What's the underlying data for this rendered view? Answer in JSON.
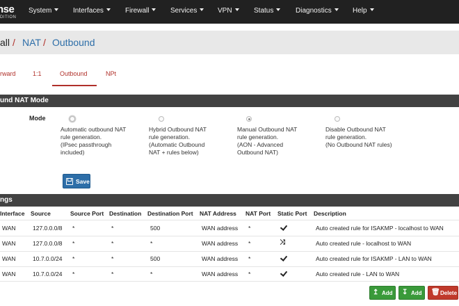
{
  "nav": {
    "brand_main": "nse",
    "brand_sub": "DITION",
    "items": [
      {
        "label": "System"
      },
      {
        "label": "Interfaces"
      },
      {
        "label": "Firewall"
      },
      {
        "label": "Services"
      },
      {
        "label": "VPN"
      },
      {
        "label": "Status"
      },
      {
        "label": "Diagnostics"
      },
      {
        "label": "Help"
      }
    ]
  },
  "breadcrumb": {
    "part1": "all",
    "sep1": "/",
    "part2": "NAT",
    "sep2": "/",
    "part3": "Outbound"
  },
  "tabs": [
    {
      "label": "rward"
    },
    {
      "label": "1:1"
    },
    {
      "label": "Outbound",
      "active": true
    },
    {
      "label": "NPt"
    }
  ],
  "mode_section": {
    "title": "und NAT Mode",
    "mode_label": "Mode",
    "options": [
      {
        "lines": [
          "Automatic outbound NAT",
          "rule generation.",
          "(IPsec passthrough",
          "included)"
        ],
        "checked": false,
        "focus": true
      },
      {
        "lines": [
          "Hybrid Outbound NAT",
          "rule generation.",
          "(Automatic Outbound",
          "NAT + rules below)"
        ],
        "checked": false
      },
      {
        "lines": [
          "Manual Outbound NAT",
          "rule generation.",
          "(AON - Advanced",
          "Outbound NAT)"
        ],
        "checked": true
      },
      {
        "lines": [
          "Disable Outbound NAT",
          "rule generation.",
          "(No Outbound NAT rules)"
        ],
        "checked": false
      }
    ],
    "save_label": "Save"
  },
  "mappings": {
    "title": "ngs",
    "columns": [
      "Interface",
      "Source",
      "Source Port",
      "Destination",
      "Destination Port",
      "NAT Address",
      "NAT Port",
      "Static Port",
      "Description"
    ],
    "rows": [
      {
        "interface": "WAN",
        "source": "127.0.0.0/8",
        "source_port": "*",
        "destination": "*",
        "destination_port": "500",
        "nat_address": "WAN address",
        "nat_port": "*",
        "static_port": "check-icon",
        "description": "Auto created rule for ISAKMP - localhost to WAN"
      },
      {
        "interface": "WAN",
        "source": "127.0.0.0/8",
        "source_port": "*",
        "destination": "*",
        "destination_port": "*",
        "nat_address": "WAN address",
        "nat_port": "*",
        "static_port": "shuffle-icon",
        "description": "Auto created rule - localhost to WAN"
      },
      {
        "interface": "WAN",
        "source": "10.7.0.0/24",
        "source_port": "*",
        "destination": "*",
        "destination_port": "500",
        "nat_address": "WAN address",
        "nat_port": "*",
        "static_port": "check-icon",
        "description": "Auto created rule for ISAKMP - LAN to WAN"
      },
      {
        "interface": "WAN",
        "source": "10.7.0.0/24",
        "source_port": "*",
        "destination": "*",
        "destination_port": "*",
        "nat_address": "WAN address",
        "nat_port": "*",
        "static_port": "check-icon",
        "description": "Auto created rule - LAN to WAN"
      }
    ]
  },
  "actions": {
    "add_top": "Add",
    "add_bottom": "Add",
    "delete": "Delete"
  },
  "colors": {
    "navbar": "#212121",
    "accent_red": "#b0302a",
    "link_blue": "#2d6ea8",
    "section_header": "#424242",
    "add_green": "#3a9a3a",
    "delete_red": "#c0392b"
  }
}
